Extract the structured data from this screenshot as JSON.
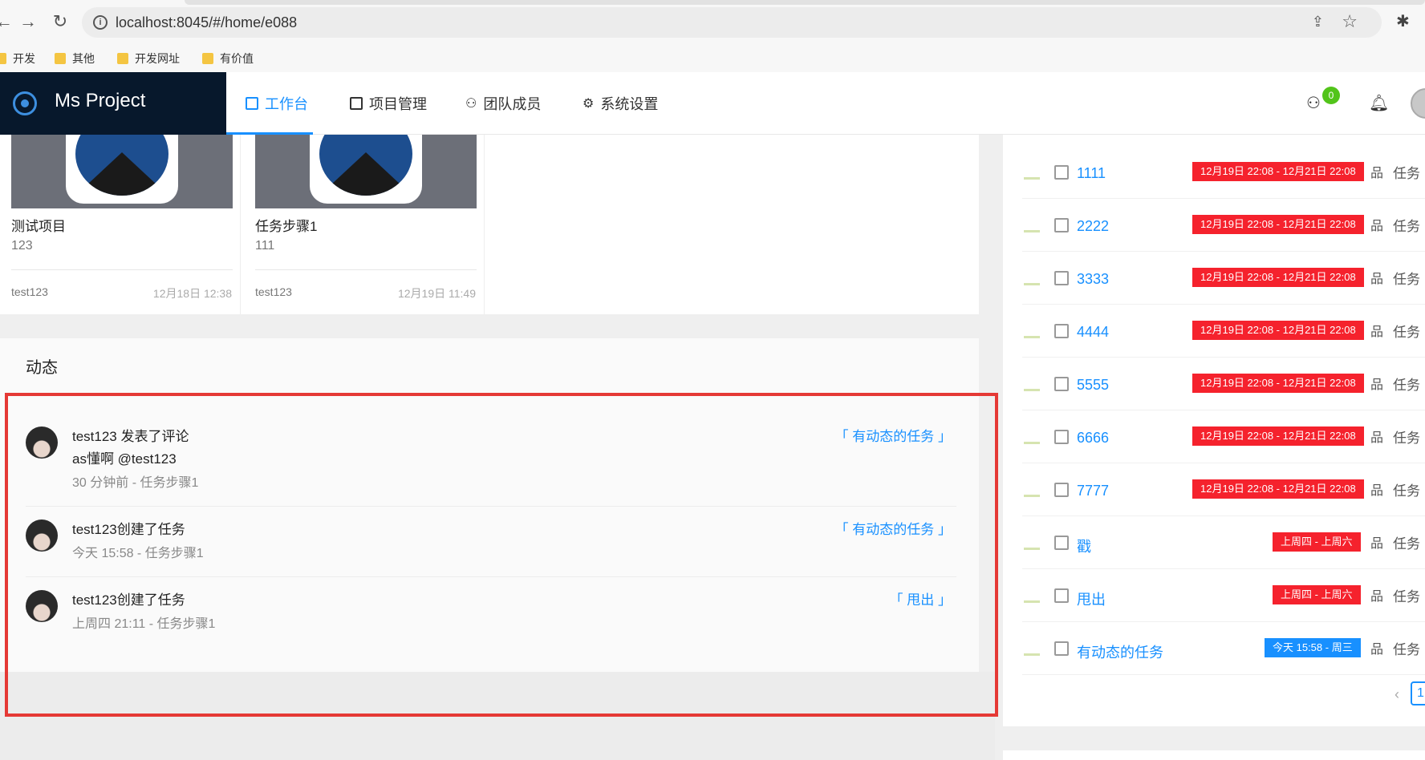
{
  "browser": {
    "url": "localhost:8045/#/home/e088",
    "bookmarks": [
      "开发",
      "其他",
      "开发网址",
      "有价值"
    ]
  },
  "header": {
    "app_name": "Ms Project",
    "menu": [
      "工作台",
      "项目管理",
      "团队成员",
      "系统设置"
    ],
    "notification_count": "0",
    "accent": "#1890ff",
    "logo_bg": "#07182c"
  },
  "projects": [
    {
      "name": "测试项目",
      "desc": "123",
      "owner": "test123",
      "date": "12月18日 12:38"
    },
    {
      "name": "任务步骤1",
      "desc": "111",
      "owner": "test123",
      "date": "12月19日 11:49"
    }
  ],
  "activity": {
    "title": "动态",
    "items": [
      {
        "line1": "test123  发表了评论",
        "line2": "as懂啊 @test123",
        "meta": "30 分钟前 - 任务步骤1",
        "link": "「 有动态的任务 」"
      },
      {
        "line1": "test123创建了任务",
        "meta": "今天 15:58 - 任务步骤1",
        "link": "「 有动态的任务 」"
      },
      {
        "line1": "test123创建了任务",
        "meta": "上周四 21:11 - 任务步骤1",
        "link": "「 甩出 」"
      }
    ]
  },
  "tasks": [
    {
      "name": "1111",
      "range": "12月19日 22:08 - 12月21日 22:08",
      "tag_color": "#f5222d",
      "type": "任务"
    },
    {
      "name": "2222",
      "range": "12月19日 22:08 - 12月21日 22:08",
      "tag_color": "#f5222d",
      "type": "任务"
    },
    {
      "name": "3333",
      "range": "12月19日 22:08 - 12月21日 22:08",
      "tag_color": "#f5222d",
      "type": "任务"
    },
    {
      "name": "4444",
      "range": "12月19日 22:08 - 12月21日 22:08",
      "tag_color": "#f5222d",
      "type": "任务"
    },
    {
      "name": "5555",
      "range": "12月19日 22:08 - 12月21日 22:08",
      "tag_color": "#f5222d",
      "type": "任务"
    },
    {
      "name": "6666",
      "range": "12月19日 22:08 - 12月21日 22:08",
      "tag_color": "#f5222d",
      "type": "任务"
    },
    {
      "name": "7777",
      "range": "12月19日 22:08 - 12月21日 22:08",
      "tag_color": "#f5222d",
      "type": "任务"
    },
    {
      "name": "戳",
      "range": "上周四 - 上周六",
      "tag_color": "#f5222d",
      "type": "任务"
    },
    {
      "name": "甩出",
      "range": "上周四 - 上周六",
      "tag_color": "#f5222d",
      "type": "任务"
    },
    {
      "name": "有动态的任务",
      "range": "今天 15:58 - 周三",
      "tag_color": "#1890ff",
      "type": "任务"
    }
  ],
  "pager": {
    "current": "1"
  }
}
